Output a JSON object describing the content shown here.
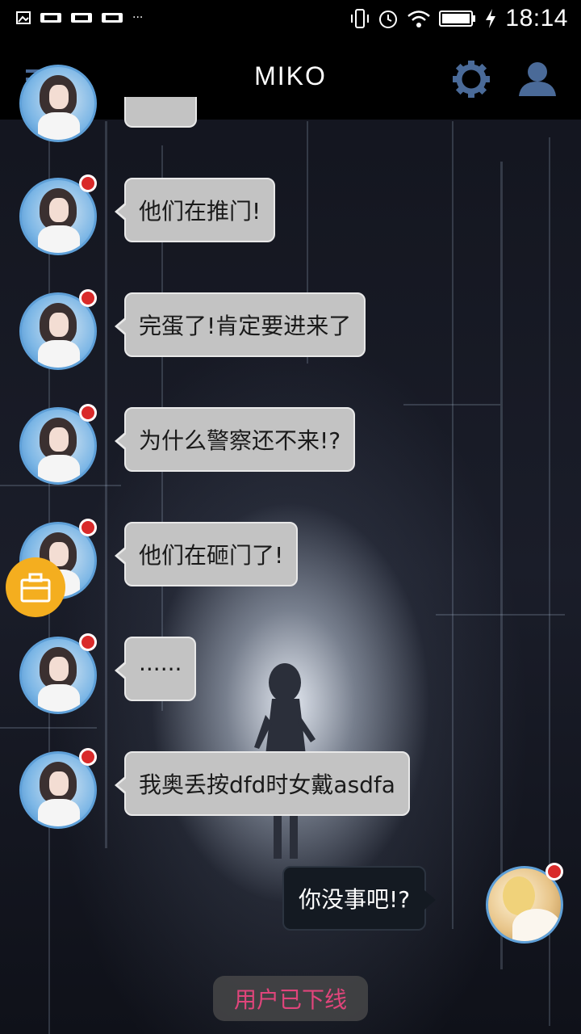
{
  "status_bar": {
    "time": "18:14",
    "left_icons": [
      "image-icon",
      "notification-icon",
      "notification-icon",
      "notification-icon",
      "more-dots"
    ],
    "right_icons": [
      "vibrate-icon",
      "alarm-icon",
      "wifi-icon",
      "battery-icon",
      "charging-icon"
    ],
    "more_label": "···"
  },
  "toolbar": {
    "title": "MIKO",
    "menu_icon": "menu-icon",
    "settings_icon": "gear-icon",
    "profile_icon": "user-icon",
    "icon_color": "#4a6a98"
  },
  "messages": [
    {
      "side": "left",
      "text": "他们在推门!"
    },
    {
      "side": "left",
      "text": "完蛋了!肯定要进来了"
    },
    {
      "side": "left",
      "text": "为什么警察还不来!?"
    },
    {
      "side": "left",
      "text": "他们在砸门了!"
    },
    {
      "side": "left",
      "text": "······"
    },
    {
      "side": "left",
      "text": "我奥丢按dfd时女戴asdfa"
    },
    {
      "side": "right",
      "text": "你没事吧!?"
    }
  ],
  "fab": {
    "icon": "bag-icon",
    "color": "#f4ae1f"
  },
  "offline_label": "用户已下线",
  "offline_color": "#e0457b"
}
